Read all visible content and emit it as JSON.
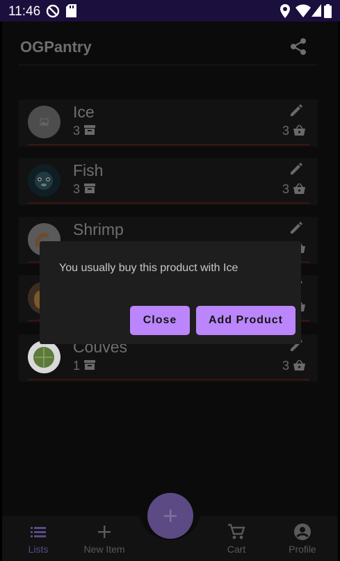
{
  "status_bar": {
    "time": "11:46"
  },
  "app_bar": {
    "title": "OGPantry"
  },
  "items": [
    {
      "name": "Ice",
      "stock_qty": "3",
      "cart_qty": "3"
    },
    {
      "name": "Fish",
      "stock_qty": "3",
      "cart_qty": "3"
    },
    {
      "name": "Shrimp",
      "stock_qty": "",
      "cart_qty": ""
    },
    {
      "name": "",
      "stock_qty": "",
      "cart_qty": ""
    },
    {
      "name": "Couves",
      "stock_qty": "1",
      "cart_qty": "3"
    }
  ],
  "dialog": {
    "message": "You usually buy this product with Ice",
    "close_label": "Close",
    "add_label": "Add Product"
  },
  "bottom_nav": {
    "lists": "Lists",
    "new_item": "New Item",
    "cart": "Cart",
    "profile": "Profile"
  },
  "colors": {
    "accent": "#bb86fc",
    "status_bar": "#1a0f3d",
    "active_nav": "#5a4a85"
  }
}
